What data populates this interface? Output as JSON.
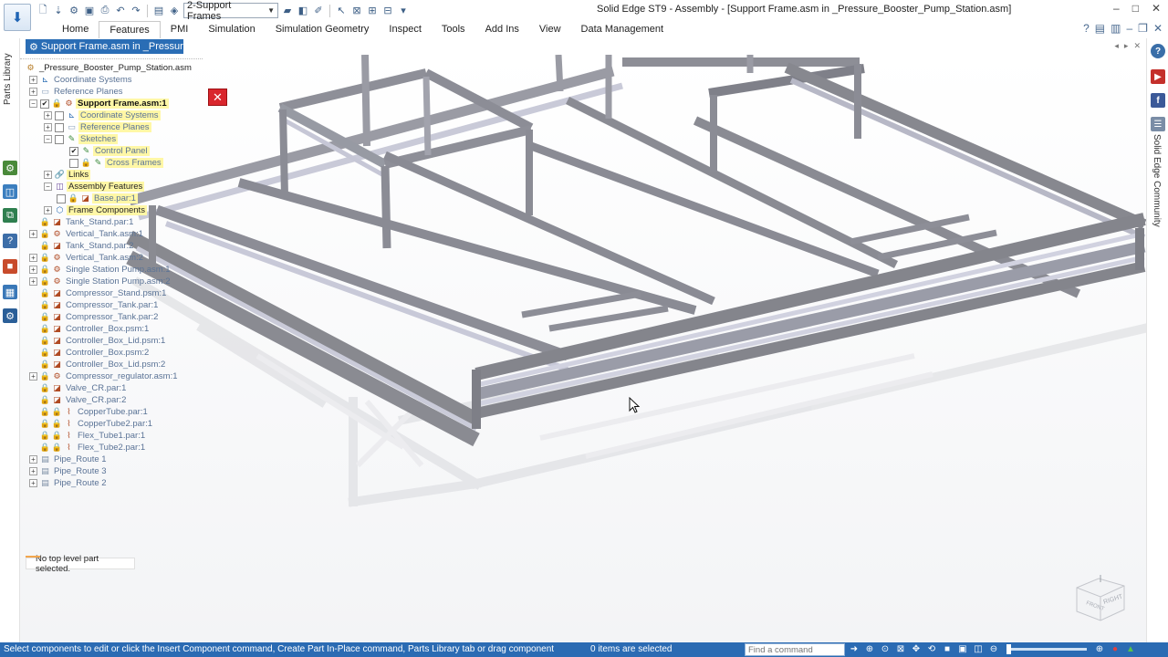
{
  "window": {
    "title": "Solid Edge ST9 - Assembly - [Support Frame.asm in _Pressure_Booster_Pump_Station.asm]",
    "controls": [
      "–",
      "□",
      "✕"
    ]
  },
  "qat": {
    "config_value": "2-Support Frames"
  },
  "ribbon": {
    "tabs": [
      "Home",
      "Features",
      "PMI",
      "Simulation",
      "Simulation Geometry",
      "Inspect",
      "Tools",
      "Add Ins",
      "View",
      "Data Management"
    ],
    "active_tab": "Features"
  },
  "doc_tab": {
    "label": "Support Frame.asm in _Pressure..."
  },
  "left_strip": {
    "label": "Parts Library"
  },
  "right_strip": {
    "label": "Solid Edge Community"
  },
  "tree": {
    "rows": [
      {
        "label": "_Pressure_Booster_Pump_Station.asm",
        "style": "plain"
      },
      {
        "label": "Coordinate Systems",
        "style": "dim"
      },
      {
        "label": "Reference Planes",
        "style": "dim"
      },
      {
        "label": "Support Frame.asm:1",
        "style": "yellow-strong"
      },
      {
        "label": "Coordinate Systems",
        "style": "yellow-dim"
      },
      {
        "label": "Reference Planes",
        "style": "yellow-dim"
      },
      {
        "label": "Sketches",
        "style": "yellow-dim"
      },
      {
        "label": "Control Panel",
        "style": "yellow-dim"
      },
      {
        "label": "Cross Frames",
        "style": "yellow-dim"
      },
      {
        "label": "Links",
        "style": "yellow"
      },
      {
        "label": "Assembly Features",
        "style": "yellow"
      },
      {
        "label": "Base.par:1",
        "style": "yellow-dim"
      },
      {
        "label": "Frame Components",
        "style": "yellow"
      },
      {
        "label": "Tank_Stand.par:1",
        "style": "dim"
      },
      {
        "label": "Vertical_Tank.asm:1",
        "style": "dim"
      },
      {
        "label": "Tank_Stand.par:2",
        "style": "dim"
      },
      {
        "label": "Vertical_Tank.asm:2",
        "style": "dim"
      },
      {
        "label": "Single Station Pump.asm:1",
        "style": "dim"
      },
      {
        "label": "Single Station Pump.asm:2",
        "style": "dim"
      },
      {
        "label": "Compressor_Stand.psm:1",
        "style": "dim"
      },
      {
        "label": "Compressor_Tank.par:1",
        "style": "dim"
      },
      {
        "label": "Compressor_Tank.par:2",
        "style": "dim"
      },
      {
        "label": "Controller_Box.psm:1",
        "style": "dim"
      },
      {
        "label": "Controller_Box_Lid.psm:1",
        "style": "dim"
      },
      {
        "label": "Controller_Box.psm:2",
        "style": "dim"
      },
      {
        "label": "Controller_Box_Lid.psm:2",
        "style": "dim"
      },
      {
        "label": "Compressor_regulator.asm:1",
        "style": "dim"
      },
      {
        "label": "Valve_CR.par:1",
        "style": "dim"
      },
      {
        "label": "Valve_CR.par:2",
        "style": "dim"
      },
      {
        "label": "CopperTube.par:1",
        "style": "dim"
      },
      {
        "label": "CopperTube2.par:1",
        "style": "dim"
      },
      {
        "label": "Flex_Tube1.par:1",
        "style": "dim"
      },
      {
        "label": "Flex_Tube2.par:1",
        "style": "dim"
      },
      {
        "label": "Pipe_Route 1",
        "style": "dim"
      },
      {
        "label": "Pipe_Route 3",
        "style": "dim"
      },
      {
        "label": "Pipe_Route 2",
        "style": "dim"
      }
    ]
  },
  "viewport": {
    "selection_status": "No top level part selected.",
    "view_cube": {
      "front": "FRONT",
      "right": "RIGHT"
    },
    "icons": {
      "close": "close-icon",
      "pointer": "mouse-pointer-icon"
    }
  },
  "statusbar": {
    "prompt": "Select components to edit or click the Insert Component command, Create Part In-Place command, Parts Library tab or drag component",
    "selection_count": "0 items are selected",
    "find_placeholder": "Find a command"
  },
  "colors": {
    "accent": "#2b6bb3",
    "tree_highlight": "#fff7a6",
    "close_red": "#d9262d"
  }
}
